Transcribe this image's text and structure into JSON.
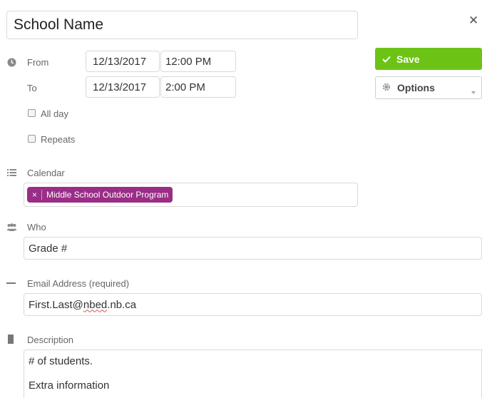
{
  "title_field": {
    "value": "School Name"
  },
  "close": {
    "symbol": "✕"
  },
  "from": {
    "label": "From",
    "date": "12/13/2017",
    "time": "12:00 PM"
  },
  "to": {
    "label": "To",
    "date": "12/13/2017",
    "time": "2:00 PM"
  },
  "all_day": {
    "label": "All day",
    "checked": false
  },
  "repeats": {
    "label": "Repeats",
    "checked": false
  },
  "save_button": {
    "label": "Save"
  },
  "options_button": {
    "label": "Options"
  },
  "calendar": {
    "label": "Calendar",
    "tag_remove": "×",
    "tag_label": "Middle School Outdoor Program",
    "tag_color": "#9a2d86"
  },
  "who": {
    "label": "Who",
    "value": "Grade #"
  },
  "email": {
    "label": "Email Address (required)",
    "value_prefix": "First.Last@",
    "value_misspelled": "nbed",
    "value_suffix": ".nb.ca"
  },
  "description": {
    "label": "Description",
    "line1": "# of students.",
    "line2": "Extra information"
  },
  "colors": {
    "accent_save": "#6cc316",
    "tag_purple": "#9a2d86"
  }
}
